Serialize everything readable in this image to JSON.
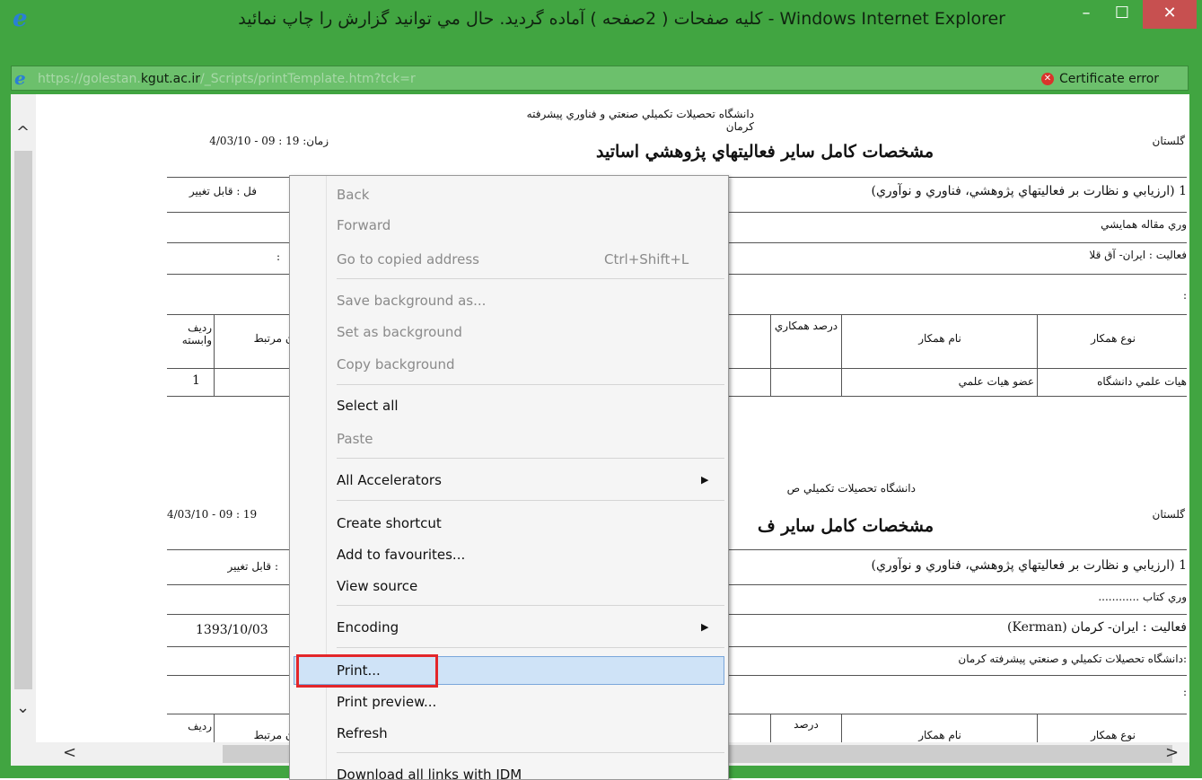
{
  "window": {
    "title": "کليه صفحات ( 2صفحه ) آماده گرديد. حال مي توانيد گزارش را چاپ نمائيد - Windows Internet Explorer",
    "minimize_glyph": "–",
    "maximize_glyph": "☐",
    "close_glyph": "✕",
    "app_icon": "e"
  },
  "address_bar": {
    "url_prefix": "https://golestan.",
    "url_host": "kgut.ac.ir",
    "url_path": "/_Scripts/printTemplate.htm?tck=r",
    "certificate_error": "Certificate error",
    "certificate_icon": "✕"
  },
  "scrollbars": {
    "up": "^",
    "down": "⌄",
    "left": "<",
    "right": ">"
  },
  "report": {
    "pages": [
      {
        "university": "دانشگاه تحصيلات تكميلي صنعتي و فناوري پيشرفته كرمان",
        "time": "زمان: 19 : 09 - 4/03/10",
        "golestan": "گلستان",
        "title": "مشخصات كامل ساير فعاليتهاي پژوهشي اساتيد",
        "category": "1 (ارزيابي و نظارت بر فعاليتهاي پژوهشي، فناوري و نوآوري)",
        "editable": "فل : قابل تغيير",
        "type": "وري مقاله همايشي",
        "place": "فعاليت : ايران- آق قلا",
        "place_value": ":",
        "colon_line": ":",
        "headers": {
          "coop_type": "نوع همكار",
          "coop_name": "نام همكار",
          "coop_percent": "درصد همكاري",
          "related": "ان مرتبط",
          "row": "رديف وابسته"
        },
        "row1": {
          "coop_type": "هيات علمي دانشگاه",
          "coop_name": "عضو هيات علمي",
          "row": "1"
        }
      },
      {
        "university": "دانشگاه تحصيلات تكميلي ص",
        "time": "4/03/10 - 09 : 19",
        "golestan": "گلستان",
        "title": "مشخصات كامل ساير ف",
        "category": "1 (ارزيابي و نظارت بر فعاليتهاي پژوهشي، فناوري و نوآوري)",
        "editable": ": قابل تغيير",
        "type": "وري كتاب ............",
        "place": "فعاليت : ايران- كرمان (Kerman)",
        "date": "1393/10/03",
        "institution": ":دانشگاه تحصيلات تكميلي و صنعتي پيشرفته كرمان",
        "colon_line": ":",
        "headers": {
          "coop_type": "نوع همكار",
          "coop_name": "نام همكار",
          "coop_percent": "درصد",
          "related": "ان مرتبط",
          "row": "رديف"
        }
      }
    ]
  },
  "context_menu": {
    "items": [
      {
        "label": "Back",
        "disabled": true
      },
      {
        "label": "Forward",
        "disabled": true
      },
      {
        "label": "Go to copied address",
        "shortcut": "Ctrl+Shift+L",
        "disabled": true
      },
      {
        "label": "Save background as...",
        "disabled": true
      },
      {
        "label": "Set as background",
        "disabled": true
      },
      {
        "label": "Copy background",
        "disabled": true
      },
      {
        "label": "Select all",
        "disabled": false
      },
      {
        "label": "Paste",
        "disabled": true
      },
      {
        "label": "All Accelerators",
        "submenu": "▶",
        "disabled": false
      },
      {
        "label": "Create shortcut",
        "disabled": false
      },
      {
        "label": "Add to favourites...",
        "disabled": false
      },
      {
        "label": "View source",
        "disabled": false
      },
      {
        "label": "Encoding",
        "submenu": "▶",
        "disabled": false
      },
      {
        "label": "Print...",
        "disabled": false,
        "highlighted": true
      },
      {
        "label": "Print preview...",
        "disabled": false
      },
      {
        "label": "Refresh",
        "disabled": false
      },
      {
        "label": "Download all links with IDM",
        "disabled": false
      }
    ]
  }
}
